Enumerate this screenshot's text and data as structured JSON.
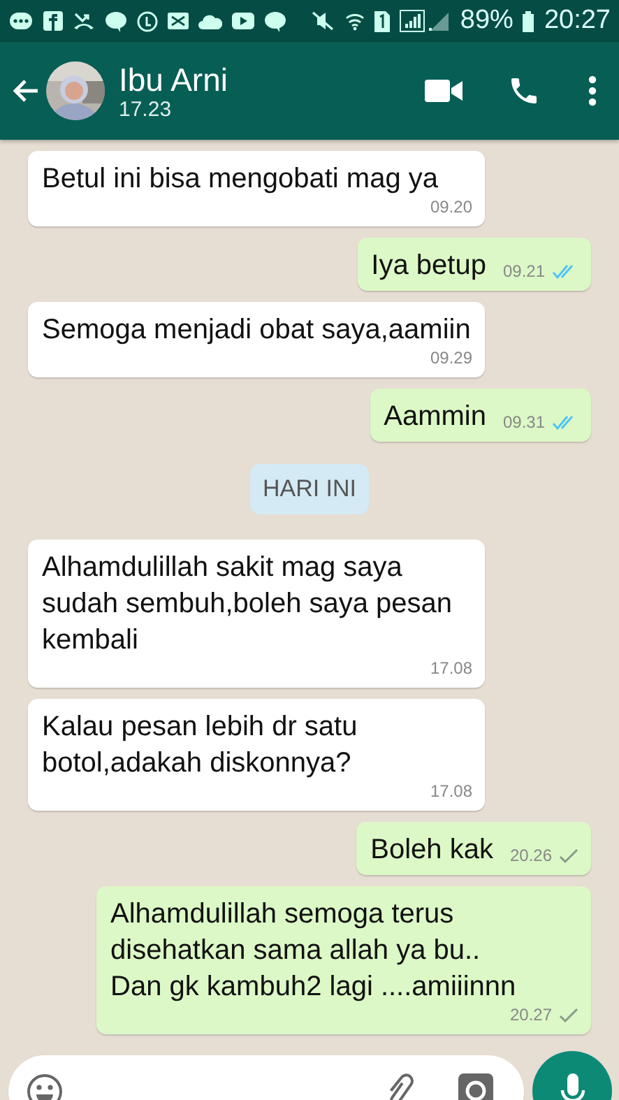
{
  "status_bar": {
    "battery": "89%",
    "time": "20:27"
  },
  "header": {
    "name": "Ibu Arni",
    "last_seen": "17.23"
  },
  "messages": [
    {
      "kind": "incoming",
      "text": "Betul ini bisa mengobati mag ya",
      "time": "09.20"
    },
    {
      "kind": "outgoing",
      "text": "Iya betup",
      "time": "09.21",
      "read": true
    },
    {
      "kind": "incoming",
      "text": "Semoga menjadi obat saya,aamiin",
      "time": "09.29"
    },
    {
      "kind": "outgoing",
      "text": "Aammin",
      "time": "09.31",
      "read": true
    },
    {
      "kind": "date",
      "text": "HARI INI"
    },
    {
      "kind": "incoming",
      "text": "Alhamdulillah sakit mag saya sudah sembuh,boleh saya pesan kembali",
      "time": "17.08"
    },
    {
      "kind": "incoming",
      "text": "Kalau pesan lebih dr satu botol,adakah diskonnya?",
      "time": "17.08"
    },
    {
      "kind": "outgoing",
      "text": "Boleh kak",
      "time": "20.26",
      "read": false
    },
    {
      "kind": "outgoing",
      "text": "Alhamdulillah semoga terus\ndisehatkan sama allah ya bu..\nDan gk kambuh2 lagi  ....amiiinnn",
      "time": "20.27",
      "read": false
    }
  ]
}
